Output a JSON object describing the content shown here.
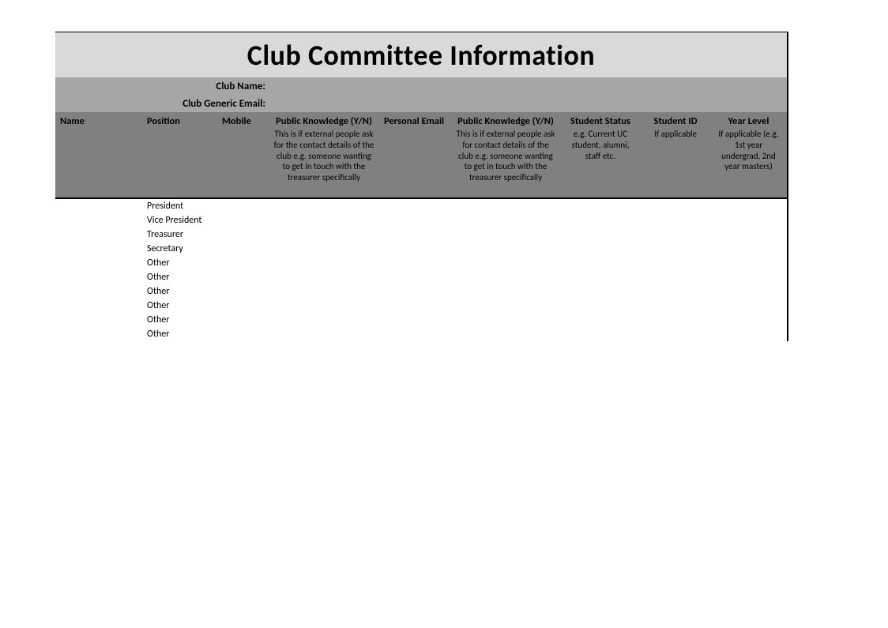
{
  "title": "Club Committee Information",
  "meta": {
    "clubNameLabel": "Club Name:",
    "clubNameValue": "",
    "clubEmailLabel": "Club Generic Email:",
    "clubEmailValue": ""
  },
  "headers": {
    "name": {
      "title": "Name",
      "sub": ""
    },
    "position": {
      "title": "Position",
      "sub": ""
    },
    "mobile": {
      "title": "Mobile",
      "sub": ""
    },
    "pk1": {
      "title": "Public Knowledge (Y/N)",
      "sub": "This is if external people ask for the contact details of the club e.g. someone wanting to get in touch with the treasurer specifically"
    },
    "email": {
      "title": "Personal Email",
      "sub": ""
    },
    "pk2": {
      "title": "Public Knowledge (Y/N)",
      "sub": "This is if external people ask for contact details of the club e.g. someone wanting to get in touch with the treasurer specifically"
    },
    "status": {
      "title": "Student Status",
      "sub": "e.g. Current UC student, alumni, staff etc."
    },
    "sid": {
      "title": "Student ID",
      "sub": "If applicable"
    },
    "year": {
      "title": "Year Level",
      "sub": "If applicable (e.g. 1st year undergrad, 2nd year masters)"
    }
  },
  "rows": [
    {
      "name": "",
      "position": "President",
      "mobile": "",
      "pk1": "",
      "email": "",
      "pk2": "",
      "status": "",
      "sid": "",
      "year": ""
    },
    {
      "name": "",
      "position": "Vice President",
      "mobile": "",
      "pk1": "",
      "email": "",
      "pk2": "",
      "status": "",
      "sid": "",
      "year": ""
    },
    {
      "name": "",
      "position": "Treasurer",
      "mobile": "",
      "pk1": "",
      "email": "",
      "pk2": "",
      "status": "",
      "sid": "",
      "year": ""
    },
    {
      "name": "",
      "position": "Secretary",
      "mobile": "",
      "pk1": "",
      "email": "",
      "pk2": "",
      "status": "",
      "sid": "",
      "year": ""
    },
    {
      "name": "",
      "position": "Other",
      "mobile": "",
      "pk1": "",
      "email": "",
      "pk2": "",
      "status": "",
      "sid": "",
      "year": ""
    },
    {
      "name": "",
      "position": "Other",
      "mobile": "",
      "pk1": "",
      "email": "",
      "pk2": "",
      "status": "",
      "sid": "",
      "year": ""
    },
    {
      "name": "",
      "position": "Other",
      "mobile": "",
      "pk1": "",
      "email": "",
      "pk2": "",
      "status": "",
      "sid": "",
      "year": ""
    },
    {
      "name": "",
      "position": "Other",
      "mobile": "",
      "pk1": "",
      "email": "",
      "pk2": "",
      "status": "",
      "sid": "",
      "year": ""
    },
    {
      "name": "",
      "position": "Other",
      "mobile": "",
      "pk1": "",
      "email": "",
      "pk2": "",
      "status": "",
      "sid": "",
      "year": ""
    },
    {
      "name": "",
      "position": "Other",
      "mobile": "",
      "pk1": "",
      "email": "",
      "pk2": "",
      "status": "",
      "sid": "",
      "year": ""
    }
  ]
}
